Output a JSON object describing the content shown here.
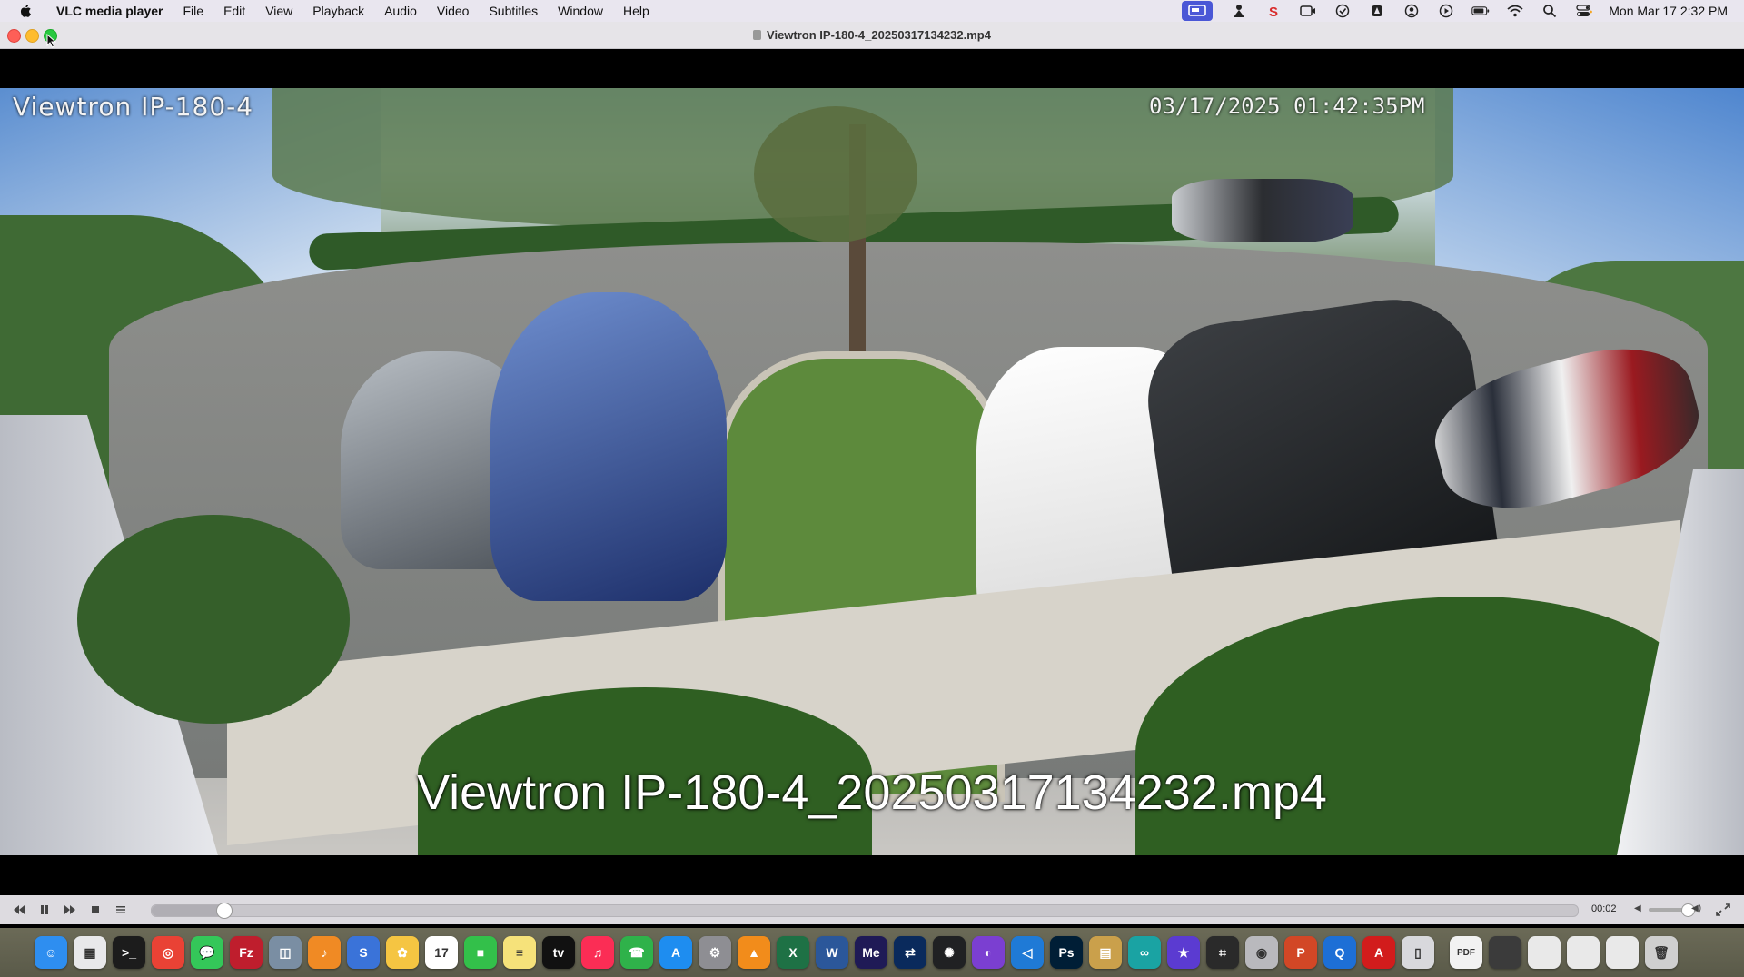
{
  "menubar": {
    "app_name": "VLC media player",
    "items": [
      "File",
      "Edit",
      "View",
      "Playback",
      "Audio",
      "Video",
      "Subtitles",
      "Window",
      "Help"
    ],
    "clock": "Mon Mar 17  2:32 PM"
  },
  "window": {
    "title": "Viewtron IP-180-4_20250317134232.mp4"
  },
  "video": {
    "osd_camera": "Viewtron IP-180-4",
    "osd_timestamp": "03/17/2025 01:42:35PM",
    "osd_filename": "Viewtron IP-180-4_20250317134232.mp4"
  },
  "controller": {
    "elapsed": "00:02",
    "progress_fraction": 0.05,
    "volume_fraction": 0.75
  },
  "dock": {
    "apps": [
      {
        "name": "finder-icon",
        "color": "#2e8ef0",
        "glyph": "☺"
      },
      {
        "name": "launchpad-icon",
        "color": "#e8e8ea",
        "glyph": "▦"
      },
      {
        "name": "terminal-icon",
        "color": "#1c1c1c",
        "glyph": ">_"
      },
      {
        "name": "chrome-icon",
        "color": "#e94235",
        "glyph": "◎"
      },
      {
        "name": "messages-icon",
        "color": "#34c759",
        "glyph": "💬"
      },
      {
        "name": "filezilla-icon",
        "color": "#bf1e2d",
        "glyph": "Fz"
      },
      {
        "name": "preview-icon",
        "color": "#7a8ea3",
        "glyph": "◫"
      },
      {
        "name": "garageband-icon",
        "color": "#f08a24",
        "glyph": "♪"
      },
      {
        "name": "sublime-icon",
        "color": "#3a73d9",
        "glyph": "S"
      },
      {
        "name": "photos-icon",
        "color": "#f5c542",
        "glyph": "✿"
      },
      {
        "name": "calendar-icon",
        "color": "#ffffff",
        "glyph": "17"
      },
      {
        "name": "facetime-icon",
        "color": "#33c04a",
        "glyph": "■"
      },
      {
        "name": "notes-icon",
        "color": "#f6e27a",
        "glyph": "≡"
      },
      {
        "name": "appletv-icon",
        "color": "#111111",
        "glyph": "tv"
      },
      {
        "name": "music-icon",
        "color": "#fb2d55",
        "glyph": "♫"
      },
      {
        "name": "phone-icon",
        "color": "#2fb24a",
        "glyph": "☎"
      },
      {
        "name": "appstore-icon",
        "color": "#1e8df0",
        "glyph": "A"
      },
      {
        "name": "settings-icon",
        "color": "#8e8e93",
        "glyph": "⚙"
      },
      {
        "name": "vlc-icon",
        "color": "#f28c1b",
        "glyph": "▲"
      },
      {
        "name": "excel-icon",
        "color": "#1e7145",
        "glyph": "X"
      },
      {
        "name": "word-icon",
        "color": "#2b579a",
        "glyph": "W"
      },
      {
        "name": "media-encoder-icon",
        "color": "#1f1a56",
        "glyph": "Me"
      },
      {
        "name": "remote-icon",
        "color": "#0a2a5c",
        "glyph": "⇄"
      },
      {
        "name": "chatgpt-icon",
        "color": "#202123",
        "glyph": "✺"
      },
      {
        "name": "github-icon",
        "color": "#7b3fd1",
        "glyph": "◐"
      },
      {
        "name": "vscode-icon",
        "color": "#1f7ad6",
        "glyph": "◁"
      },
      {
        "name": "photoshop-icon",
        "color": "#001e36",
        "glyph": "Ps"
      },
      {
        "name": "archive-icon",
        "color": "#caa04b",
        "glyph": "▤"
      },
      {
        "name": "infinity-icon",
        "color": "#1aa3a3",
        "glyph": "∞"
      },
      {
        "name": "imovie-icon",
        "color": "#5b3bd1",
        "glyph": "★"
      },
      {
        "name": "screenshot-icon",
        "color": "#2a2a2a",
        "glyph": "⌗"
      },
      {
        "name": "disk-utility-icon",
        "color": "#b9b9bd",
        "glyph": "◉"
      },
      {
        "name": "powerpoint-icon",
        "color": "#d24726",
        "glyph": "P"
      },
      {
        "name": "browser-icon",
        "color": "#1d6fd6",
        "glyph": "Q"
      },
      {
        "name": "acrobat-icon",
        "color": "#d21c1c",
        "glyph": "A"
      },
      {
        "name": "device-icon",
        "color": "#d8d8dc",
        "glyph": "▯"
      },
      {
        "name": "pdf-file-icon",
        "color": "#f2f2f2",
        "glyph": "PDF"
      },
      {
        "name": "window-thumb-1-icon",
        "color": "#3b3b3b",
        "glyph": ""
      },
      {
        "name": "window-thumb-2-icon",
        "color": "#e9e9e9",
        "glyph": ""
      },
      {
        "name": "window-thumb-3-icon",
        "color": "#e9e9e9",
        "glyph": ""
      },
      {
        "name": "window-thumb-4-icon",
        "color": "#e9e9e9",
        "glyph": ""
      },
      {
        "name": "trash-icon",
        "color": "#cfcfcf",
        "glyph": "🗑"
      }
    ]
  }
}
